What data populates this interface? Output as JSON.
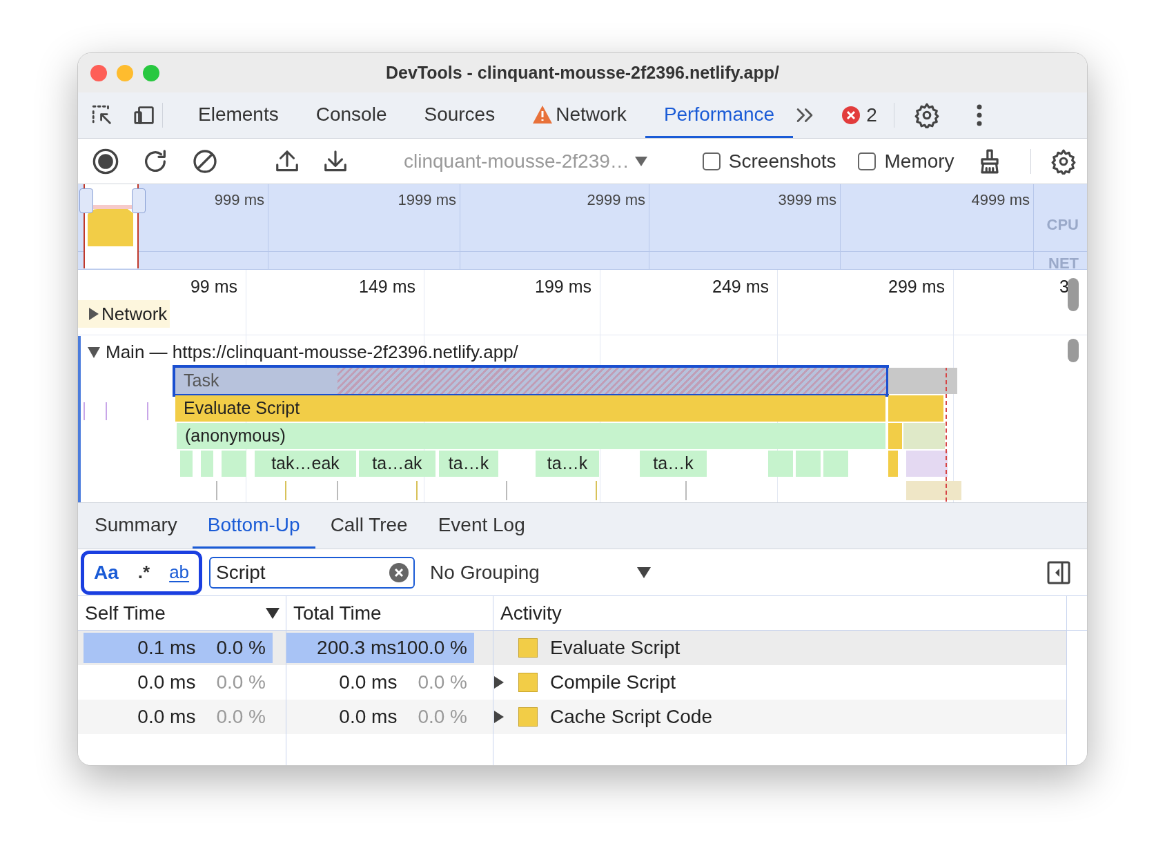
{
  "window": {
    "title": "DevTools - clinquant-mousse-2f2396.netlify.app/"
  },
  "main_tabs": [
    {
      "label": "Elements",
      "selected": false,
      "warning": false
    },
    {
      "label": "Console",
      "selected": false,
      "warning": false
    },
    {
      "label": "Sources",
      "selected": false,
      "warning": false
    },
    {
      "label": "Network",
      "selected": false,
      "warning": true
    },
    {
      "label": "Performance",
      "selected": true,
      "warning": false
    }
  ],
  "error_count": "2",
  "toolbar": {
    "target": "clinquant-mousse-2f239…",
    "checkboxes": [
      {
        "label": "Screenshots",
        "checked": false
      },
      {
        "label": "Memory",
        "checked": false
      }
    ]
  },
  "overview": {
    "ticks": [
      "999 ms",
      "1999 ms",
      "2999 ms",
      "3999 ms",
      "4999 ms"
    ],
    "lanes": [
      "CPU",
      "NET"
    ]
  },
  "ruler": {
    "ticks": [
      "99 ms",
      "149 ms",
      "199 ms",
      "249 ms",
      "299 ms",
      "3"
    ]
  },
  "tracks": [
    {
      "title": "Network",
      "expanded": false
    },
    {
      "title": "Main — https://clinquant-mousse-2f2396.netlify.app/",
      "expanded": true
    }
  ],
  "flame_rows": [
    {
      "entries": [
        {
          "label": "Task",
          "kind": "task",
          "selected": true
        }
      ]
    },
    {
      "entries": [
        {
          "label": "Evaluate Script",
          "kind": "script",
          "selected": false
        }
      ]
    },
    {
      "entries": [
        {
          "label": "(anonymous)",
          "kind": "function",
          "selected": false
        }
      ]
    },
    {
      "entries": [
        {
          "label": "tak…eak",
          "kind": "function",
          "selected": false
        },
        {
          "label": "ta…ak",
          "kind": "function",
          "selected": false
        },
        {
          "label": "ta…k",
          "kind": "function",
          "selected": false
        },
        {
          "label": "ta…k",
          "kind": "function",
          "selected": false
        },
        {
          "label": "ta…k",
          "kind": "function",
          "selected": false
        }
      ]
    }
  ],
  "detail_tabs": [
    {
      "label": "Summary",
      "selected": false
    },
    {
      "label": "Bottom-Up",
      "selected": true
    },
    {
      "label": "Call Tree",
      "selected": false
    },
    {
      "label": "Event Log",
      "selected": false
    }
  ],
  "filter": {
    "match_case": true,
    "regex": false,
    "whole_word": true,
    "match_case_label": "Aa",
    "regex_label": ".*",
    "whole_word_label": "ab",
    "value": "Script",
    "grouping": "No Grouping"
  },
  "table": {
    "columns": [
      {
        "label": "Self Time",
        "sorted": true
      },
      {
        "label": "Total Time",
        "sorted": false
      },
      {
        "label": "Activity",
        "sorted": false
      }
    ],
    "rows": [
      {
        "self_time": "0.1 ms",
        "self_percent": "0.0 %",
        "total_time": "200.3 ms",
        "total_percent": "100.0 %",
        "activity": "Evaluate Script",
        "expandable": false,
        "selected": true
      },
      {
        "self_time": "0.0 ms",
        "self_percent": "0.0 %",
        "total_time": "0.0 ms",
        "total_percent": "0.0 %",
        "activity": "Compile Script",
        "expandable": true,
        "selected": false
      },
      {
        "self_time": "0.0 ms",
        "self_percent": "0.0 %",
        "total_time": "0.0 ms",
        "total_percent": "0.0 %",
        "activity": "Cache Script Code",
        "expandable": true,
        "selected": false
      }
    ]
  }
}
